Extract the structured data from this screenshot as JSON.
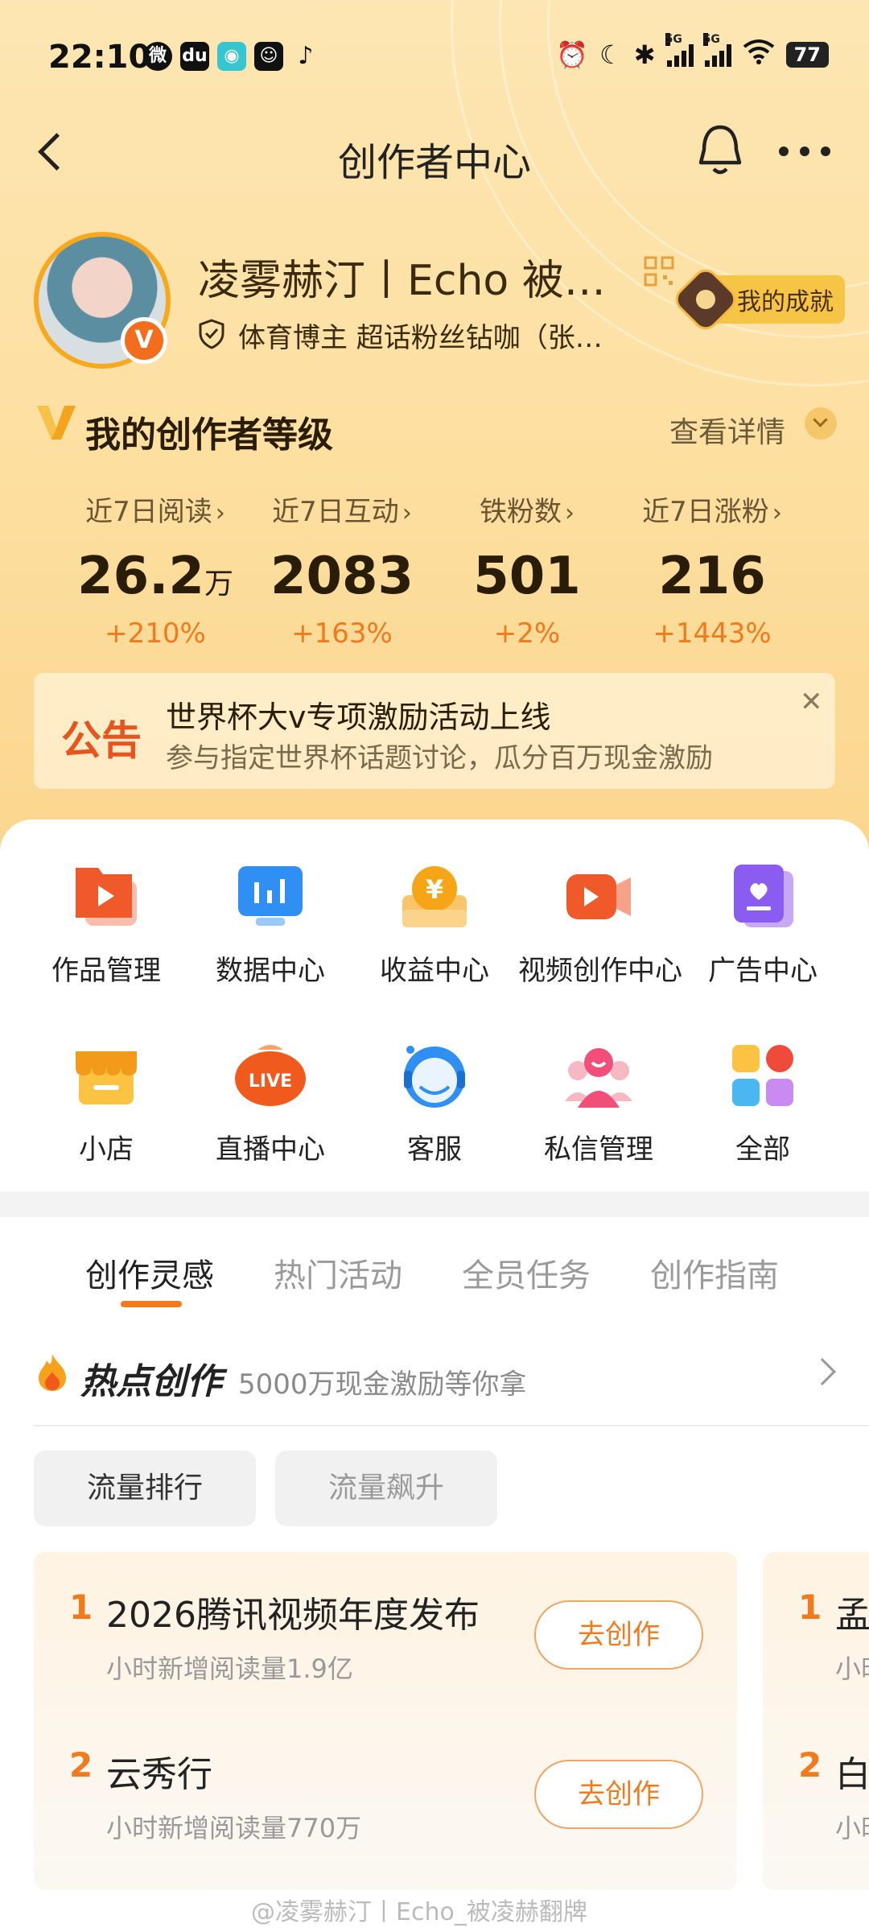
{
  "status_bar": {
    "time": "22:10",
    "battery": "77",
    "network": "5G",
    "app_icons": [
      "weibo-icon",
      "du-icon",
      "game-icon",
      "smile-app-icon",
      "tiktok-icon"
    ]
  },
  "header": {
    "title": "创作者中心",
    "back_label": "back",
    "icons": [
      "bell-icon",
      "more-icon"
    ]
  },
  "profile": {
    "username": "凌雾赫汀丨Echo  被…",
    "verification": "体育博主 超话粉丝钻咖（张…",
    "badge": "V",
    "achievement_label": "我的成就"
  },
  "creator_level": {
    "title": "我的创作者等级",
    "detail_link": "查看详情",
    "stats": [
      {
        "label": "近7日阅读",
        "value": "26.2",
        "unit": "万",
        "change": "+210%"
      },
      {
        "label": "近7日互动",
        "value": "2083",
        "unit": "",
        "change": "+163%"
      },
      {
        "label": "铁粉数",
        "value": "501",
        "unit": "",
        "change": "+2%"
      },
      {
        "label": "近7日涨粉",
        "value": "216",
        "unit": "",
        "change": "+1443%"
      }
    ]
  },
  "notice": {
    "tag": "公告",
    "title": "世界杯大v专项激励活动上线",
    "subtitle": "参与指定世界杯话题讨论，瓜分百万现金激励",
    "close": "✕"
  },
  "tools": [
    {
      "label": "作品管理",
      "icon": "works-icon"
    },
    {
      "label": "数据中心",
      "icon": "data-icon"
    },
    {
      "label": "收益中心",
      "icon": "income-icon"
    },
    {
      "label": "视频创作中心",
      "icon": "video-icon"
    },
    {
      "label": "广告中心",
      "icon": "ad-icon"
    },
    {
      "label": "小店",
      "icon": "shop-icon"
    },
    {
      "label": "直播中心",
      "icon": "live-icon"
    },
    {
      "label": "客服",
      "icon": "service-icon"
    },
    {
      "label": "私信管理",
      "icon": "message-icon"
    },
    {
      "label": "全部",
      "icon": "all-icon"
    }
  ],
  "tabs": [
    {
      "label": "创作灵感",
      "active": true
    },
    {
      "label": "热门活动",
      "active": false
    },
    {
      "label": "全员任务",
      "active": false
    },
    {
      "label": "创作指南",
      "active": false
    }
  ],
  "hot": {
    "title": "热点创作",
    "subtitle": "5000万现金激励等你拿"
  },
  "filters": [
    {
      "label": "流量排行",
      "active": true
    },
    {
      "label": "流量飙升",
      "active": false
    }
  ],
  "trend_cards": [
    {
      "items": [
        {
          "rank": "1",
          "title": "2026腾讯视频年度发布",
          "sub": "小时新增阅读量1.9亿",
          "button": "去创作"
        },
        {
          "rank": "2",
          "title": "云秀行",
          "sub": "小时新增阅读量770万",
          "button": "去创作"
        }
      ]
    },
    {
      "items": [
        {
          "rank": "1",
          "title": "孟",
          "sub": "小时"
        },
        {
          "rank": "2",
          "title": "白",
          "sub": "小时"
        }
      ]
    }
  ],
  "watermark": "@凌雾赫汀丨Echo_被凌赫翻牌",
  "colors": {
    "accent": "#f07a1c",
    "header_bg": "#fde6b3",
    "notice_tag": "#e8541d"
  }
}
